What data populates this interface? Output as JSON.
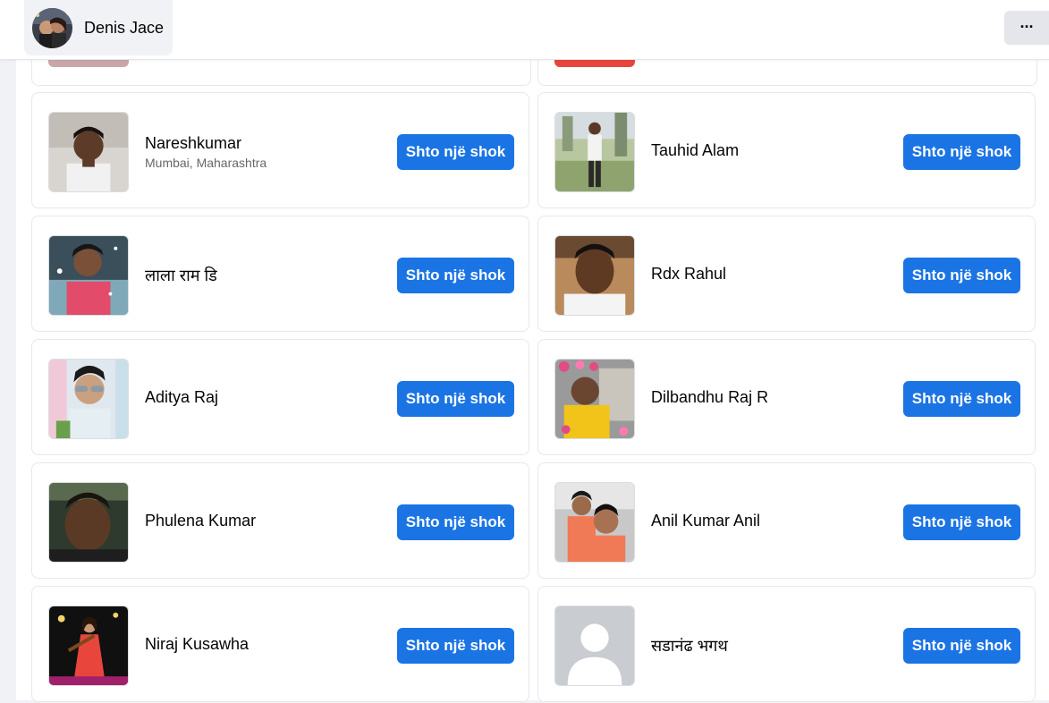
{
  "header": {
    "profile_name": "Denis Jace",
    "more_label": "···"
  },
  "add_friend_label": "Shto një shok",
  "suggestions": [
    {
      "name": "Nareshkumar",
      "subtitle": "Mumbai, Maharashtra",
      "photo": "photo-young-man-indoor"
    },
    {
      "name": "Tauhid Alam",
      "subtitle": "",
      "photo": "photo-man-outdoor"
    },
    {
      "name": "लाला राम डि",
      "subtitle": "",
      "photo": "photo-boy-sparkles"
    },
    {
      "name": "Rdx Rahul",
      "subtitle": "",
      "photo": "photo-young-man-selfie"
    },
    {
      "name": "Aditya Raj",
      "subtitle": "",
      "photo": "photo-man-sunglasses"
    },
    {
      "name": "Dilbandhu Raj R",
      "subtitle": "",
      "photo": "photo-man-flowers"
    },
    {
      "name": "Phulena Kumar",
      "subtitle": "",
      "photo": "photo-man-dark"
    },
    {
      "name": "Anil Kumar Anil",
      "subtitle": "",
      "photo": "photo-two-men"
    },
    {
      "name": "Niraj Kusawha",
      "subtitle": "",
      "photo": "photo-dancer-stage"
    },
    {
      "name": "सडानंढ भगथ",
      "subtitle": "",
      "photo": "default-avatar"
    }
  ],
  "colors": {
    "primary_button": "#1b74e4",
    "background": "#f0f2f5",
    "card_border": "#e7e8ea",
    "secondary_text": "#65676b"
  }
}
